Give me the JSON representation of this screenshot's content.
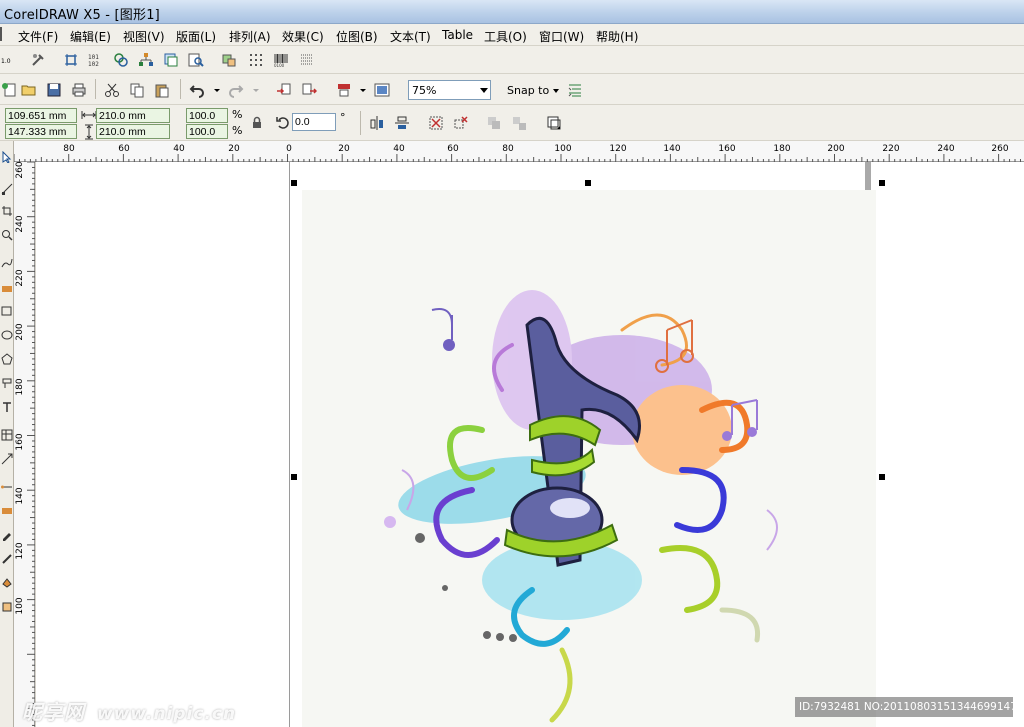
{
  "window": {
    "title": "CorelDRAW X5 - [图形1]"
  },
  "menu": [
    {
      "label": "文件(F)",
      "name": "menu-file"
    },
    {
      "label": "编辑(E)",
      "name": "menu-edit"
    },
    {
      "label": "视图(V)",
      "name": "menu-view"
    },
    {
      "label": "版面(L)",
      "name": "menu-layout"
    },
    {
      "label": "排列(A)",
      "name": "menu-arrange"
    },
    {
      "label": "效果(C)",
      "name": "menu-effects"
    },
    {
      "label": "位图(B)",
      "name": "menu-bitmaps"
    },
    {
      "label": "文本(T)",
      "name": "menu-text"
    },
    {
      "label": "Table",
      "name": "menu-table"
    },
    {
      "label": "工具(O)",
      "name": "menu-tools"
    },
    {
      "label": "窗口(W)",
      "name": "menu-window"
    },
    {
      "label": "帮助(H)",
      "name": "menu-help"
    }
  ],
  "standard_toolbar": {
    "zoom": "75%",
    "snap_to": "Snap to"
  },
  "property_bar": {
    "x": "109.651 mm",
    "y": "147.333 mm",
    "width": "210.0 mm",
    "height": "210.0 mm",
    "scale_x": "100.0",
    "scale_y": "100.0",
    "percent_symbol": "%",
    "rotation": "0.0",
    "degree_symbol": "°"
  },
  "ruler_h": [
    "80",
    "60",
    "40",
    "20",
    "0",
    "20",
    "40",
    "60",
    "80",
    "100",
    "120",
    "140",
    "160",
    "180",
    "200",
    "220",
    "240",
    "260"
  ],
  "ruler_v": [
    "260",
    "240",
    "220",
    "200",
    "180",
    "160",
    "140",
    "120",
    "100"
  ],
  "watermark": {
    "brand": "昵享网",
    "url": "www.nipic.cn",
    "id_text": "ID:7932481 NO:20110803151344699147"
  },
  "colors": {
    "accent_green_field": "#eaf5e3",
    "page_background": "#f6f7f3"
  }
}
